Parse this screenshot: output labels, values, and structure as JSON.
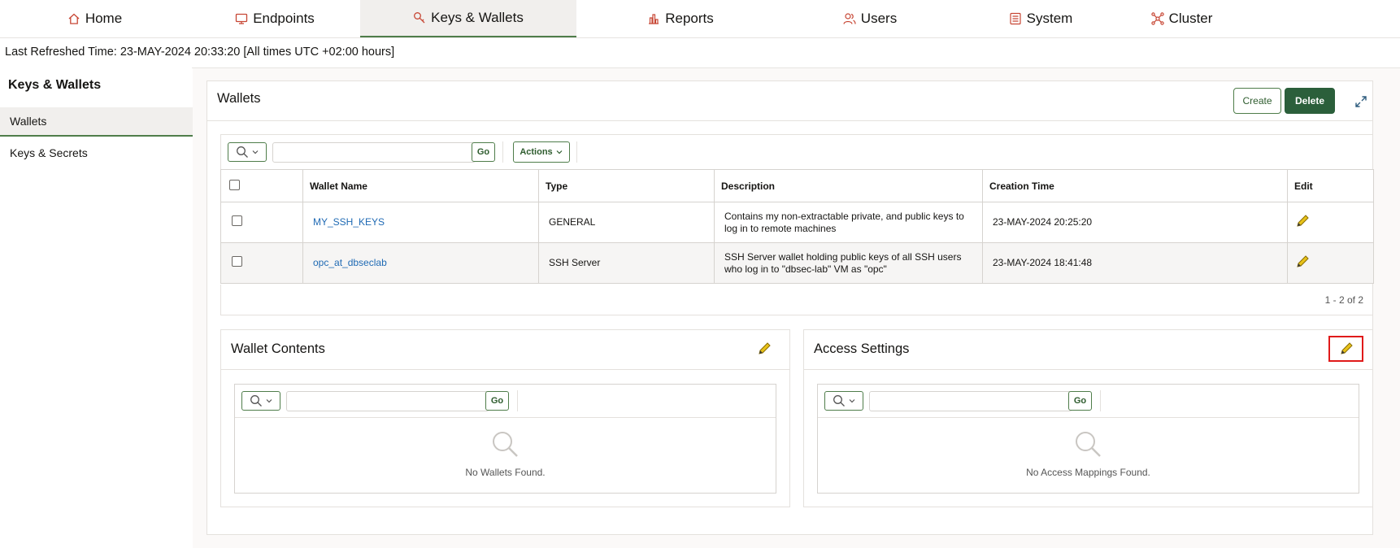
{
  "nav": {
    "tabs": [
      {
        "label": "Home",
        "icon": "home-icon"
      },
      {
        "label": "Endpoints",
        "icon": "monitor-icon"
      },
      {
        "label": "Keys & Wallets",
        "icon": "key-icon",
        "active": true
      },
      {
        "label": "Reports",
        "icon": "bar-chart-icon"
      },
      {
        "label": "Users",
        "icon": "users-icon"
      },
      {
        "label": "System",
        "icon": "list-icon"
      },
      {
        "label": "Cluster",
        "icon": "network-icon"
      }
    ]
  },
  "refresh": {
    "text": "Last Refreshed Time: 23-MAY-2024 20:33:20 [All times UTC +02:00 hours]"
  },
  "sidebar": {
    "title": "Keys & Wallets",
    "items": [
      {
        "label": "Wallets",
        "active": true
      },
      {
        "label": "Keys & Secrets"
      }
    ]
  },
  "wallets": {
    "title": "Wallets",
    "create_label": "Create",
    "delete_label": "Delete",
    "go_label": "Go",
    "actions_label": "Actions",
    "columns": [
      "Wallet Name",
      "Type",
      "Description",
      "Creation Time",
      "Edit"
    ],
    "rows": [
      {
        "name": "MY_SSH_KEYS",
        "type": "GENERAL",
        "description": "Contains my non-extractable private, and public keys to log in to remote machines",
        "created": "23-MAY-2024 20:25:20"
      },
      {
        "name": "opc_at_dbseclab",
        "type": "SSH Server",
        "description": "SSH Server wallet holding public keys of all SSH users who log in to \"dbsec-lab\" VM as \"opc\"",
        "created": "23-MAY-2024 18:41:48"
      }
    ],
    "pagination": "1 - 2 of 2"
  },
  "wallet_contents": {
    "title": "Wallet Contents",
    "go_label": "Go",
    "empty_text": "No Wallets Found."
  },
  "access_settings": {
    "title": "Access Settings",
    "go_label": "Go",
    "empty_text": "No Access Mappings Found."
  },
  "colors": {
    "accent_green": "#2b5f3b",
    "nav_icon_red": "#c74634",
    "link_blue": "#1f6ab4",
    "highlight_red": "#e01a1a",
    "pencil_yellow": "#e8c21a"
  }
}
